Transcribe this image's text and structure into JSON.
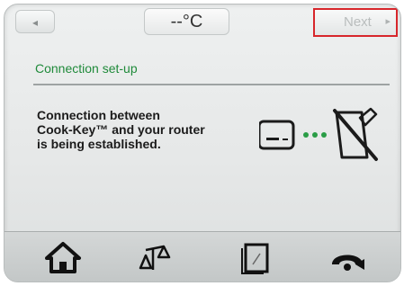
{
  "topbar": {
    "prev_label": "◂",
    "temperature": "--°C",
    "next_label": "Next",
    "next_arrow": "▸"
  },
  "content": {
    "section_title": "Connection set-up",
    "message_lines": [
      "Connection between",
      "Cook-Key™ and your router",
      "is being established."
    ]
  },
  "bottombar": {
    "items": [
      {
        "icon": "home-icon"
      },
      {
        "icon": "scale-icon"
      },
      {
        "icon": "recipe-book-icon"
      },
      {
        "icon": "return-icon"
      }
    ]
  },
  "colors": {
    "accent_green": "#1f8a3a",
    "highlight_red": "#d7262b"
  }
}
